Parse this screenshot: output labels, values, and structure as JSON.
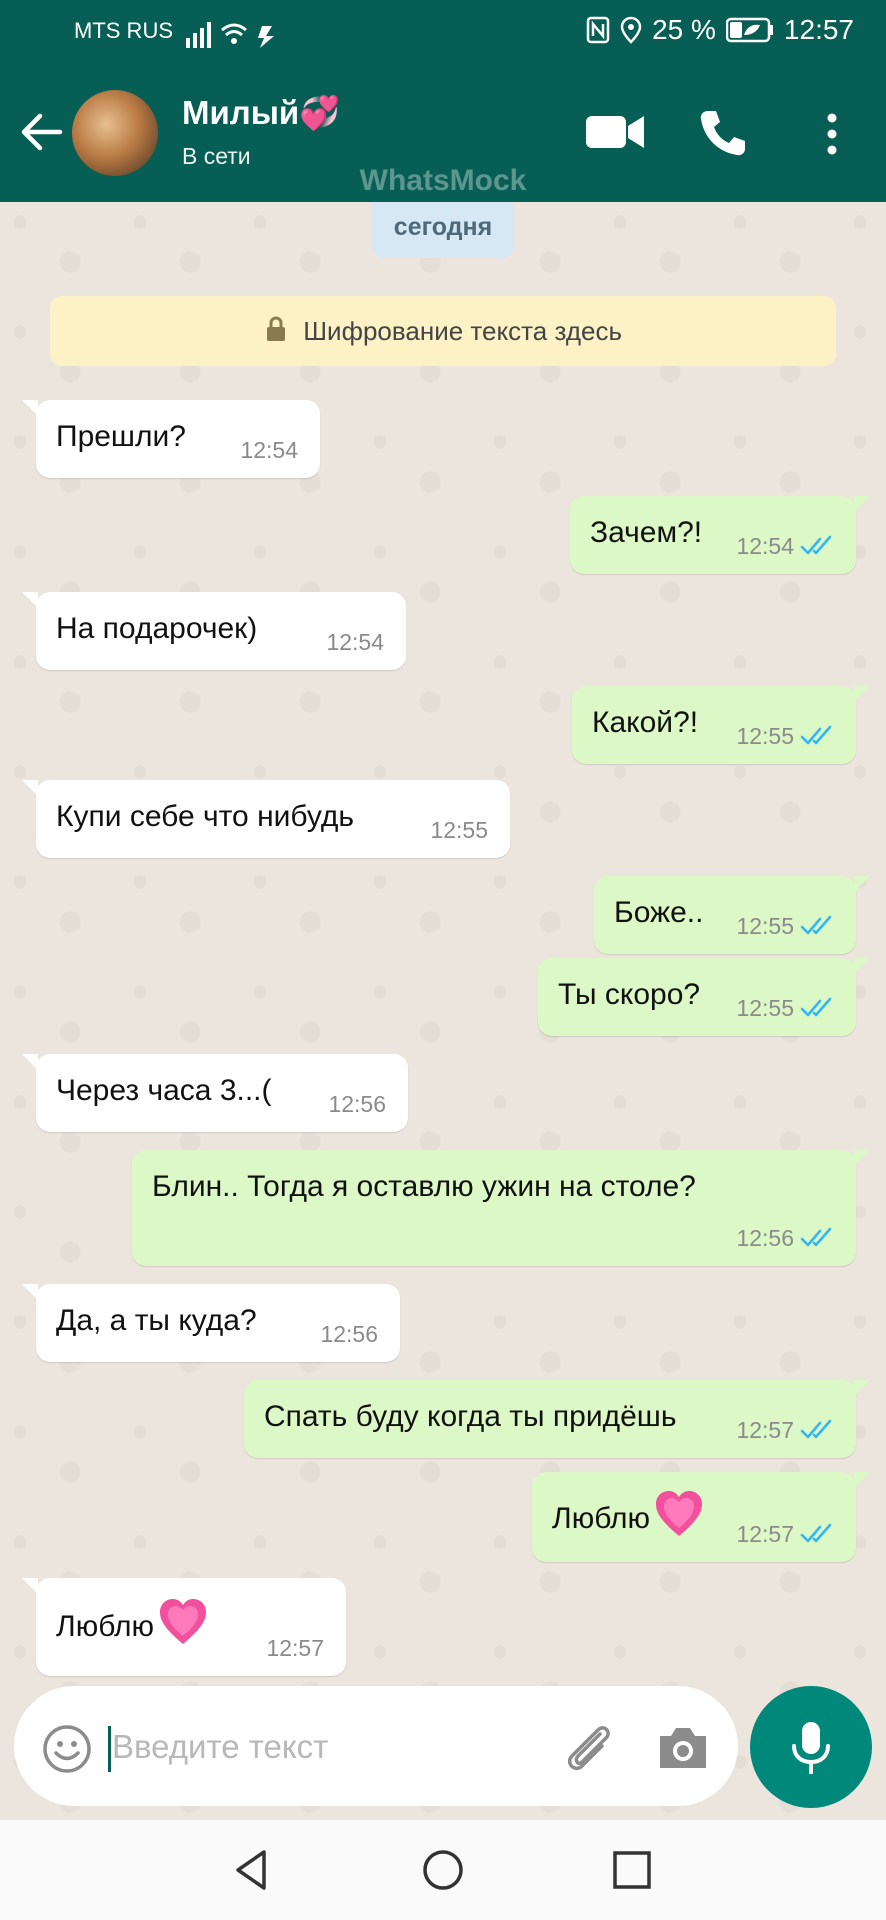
{
  "status_bar": {
    "carrier": "MTS RUS",
    "battery": "25 %",
    "time": "12:57"
  },
  "header": {
    "contact_name": "Милый💞",
    "presence": "В сети",
    "watermark": "WhatsMock"
  },
  "chat": {
    "date_label": "сегодня",
    "encryption_notice": "Шифрование текста здесь",
    "messages": [
      {
        "dir": "in",
        "text": "Прешли?",
        "time": "12:54"
      },
      {
        "dir": "out",
        "text": "Зачем?!",
        "time": "12:54"
      },
      {
        "dir": "in",
        "text": "На подарочек)",
        "time": "12:54"
      },
      {
        "dir": "out",
        "text": "Какой?!",
        "time": "12:55"
      },
      {
        "dir": "in",
        "text": "Купи себе что нибудь",
        "time": "12:55"
      },
      {
        "dir": "out",
        "text": "Боже..",
        "time": "12:55"
      },
      {
        "dir": "out",
        "text": "Ты скоро?",
        "time": "12:55"
      },
      {
        "dir": "in",
        "text": "Через часа 3...(",
        "time": "12:56"
      },
      {
        "dir": "out",
        "text": "Блин.. Тогда я оставлю ужин на столе?",
        "time": "12:56"
      },
      {
        "dir": "in",
        "text": "Да, а ты куда?",
        "time": "12:56"
      },
      {
        "dir": "out",
        "text": "Спать буду когда ты придёшь",
        "time": "12:57"
      },
      {
        "dir": "out",
        "text": "Люблю",
        "time": "12:57"
      },
      {
        "dir": "in",
        "text": "Люблю",
        "time": "12:57"
      }
    ]
  },
  "composer": {
    "placeholder": "Введите текст"
  },
  "icons": {
    "back": "arrow-left-icon",
    "video": "video-camera-icon",
    "call": "phone-icon",
    "more": "more-vertical-icon",
    "emoji": "emoji-icon",
    "attach": "paperclip-icon",
    "camera": "camera-icon",
    "mic": "microphone-icon",
    "read_receipt": "double-check-icon",
    "lock": "lock-icon",
    "heart": "growing-heart-emoji"
  },
  "colors": {
    "header": "#075E54",
    "outgoing_bubble": "#DCF8C6",
    "incoming_bubble": "#FFFFFF",
    "ticks": "#34B7F1",
    "mic_button": "#00897B"
  }
}
